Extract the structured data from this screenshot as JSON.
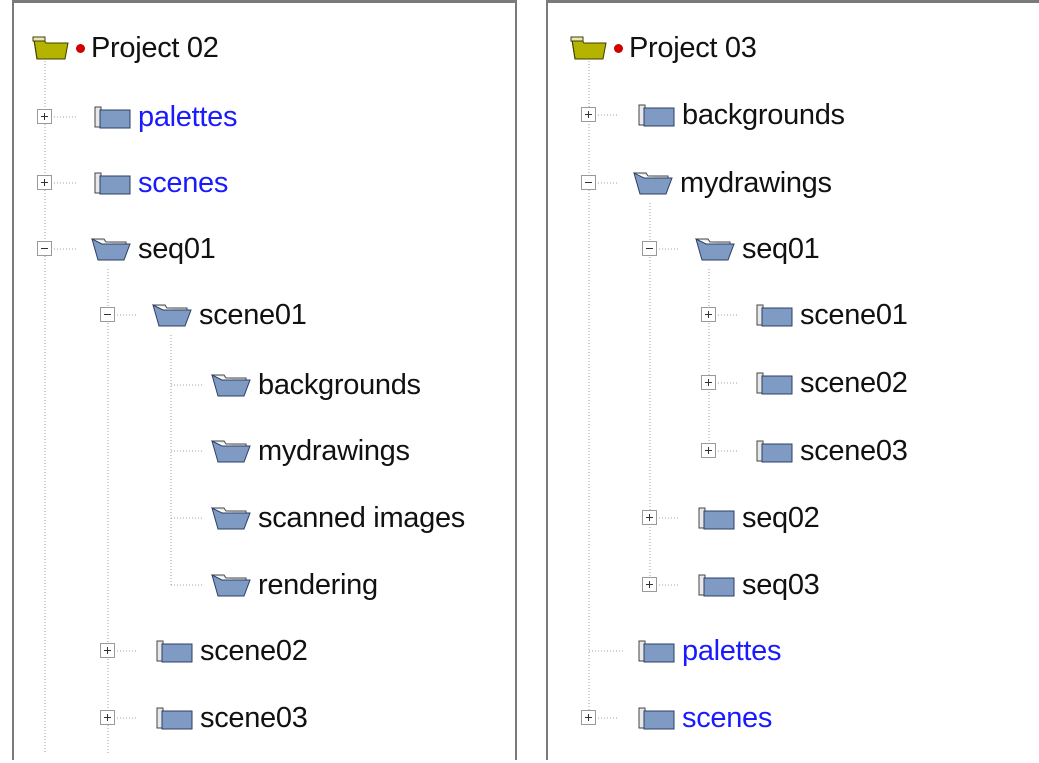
{
  "left_tree": {
    "root": "Project 02",
    "items": [
      {
        "label": "palettes",
        "link": true
      },
      {
        "label": "scenes",
        "link": true
      },
      {
        "label": "seq01",
        "link": false
      },
      {
        "label": "scene01",
        "link": false
      },
      {
        "label": "backgrounds",
        "link": false
      },
      {
        "label": "mydrawings",
        "link": false
      },
      {
        "label": "scanned images",
        "link": false
      },
      {
        "label": "rendering",
        "link": false
      },
      {
        "label": "scene02",
        "link": false
      },
      {
        "label": "scene03",
        "link": false
      }
    ]
  },
  "right_tree": {
    "root": "Project 03",
    "items": [
      {
        "label": "backgrounds",
        "link": false
      },
      {
        "label": "mydrawings",
        "link": false
      },
      {
        "label": "seq01",
        "link": false
      },
      {
        "label": "scene01",
        "link": false
      },
      {
        "label": "scene02",
        "link": false
      },
      {
        "label": "scene03",
        "link": false
      },
      {
        "label": "seq02",
        "link": false
      },
      {
        "label": "seq03",
        "link": false
      },
      {
        "label": "palettes",
        "link": true
      },
      {
        "label": "scenes",
        "link": true
      }
    ]
  },
  "colors": {
    "folder_closed": "#7f9bc4",
    "folder_open": "#7f9bc4",
    "project_folder": "#b3b300",
    "link_text": "#1a1aff",
    "modified_dot": "#d00000"
  },
  "icons": {
    "project": "project-folder-icon",
    "closed": "folder-closed-icon",
    "open": "folder-open-icon",
    "expand": "expand-plus-icon",
    "collapse": "collapse-minus-icon"
  }
}
